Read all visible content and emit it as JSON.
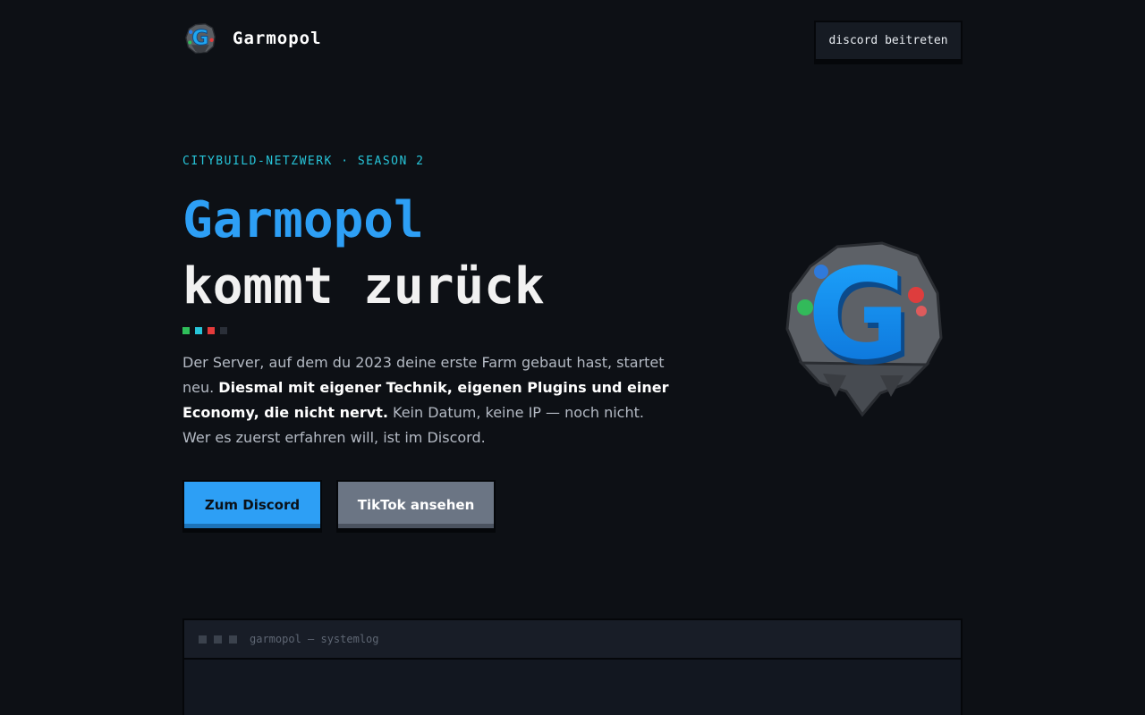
{
  "header": {
    "brand_name": "Garmopol",
    "discord_button": "discord beitreten"
  },
  "hero": {
    "eyebrow": "CITYBUILD-NETZWERK · SEASON 2",
    "headline_line1": "Garmopol",
    "headline_line2": "kommt zurück",
    "lead_part1": "Der Server, auf dem du 2023 deine erste Farm gebaut hast, startet neu. ",
    "lead_bold": "Diesmal mit eigener Technik, eigenen Plugins und einer Economy, die nicht nervt.",
    "lead_part2": " Kein Datum, keine IP — noch nicht. Wer es zuerst erfahren will, ist im Discord.",
    "primary_button": "Zum Discord",
    "secondary_button": "TikTok ansehen",
    "dot_colors": [
      "#2fbf5a",
      "#27c5d9",
      "#e53b3b",
      "#2a2f38"
    ]
  },
  "terminal": {
    "title": "garmopol — systemlog"
  },
  "colors": {
    "background": "#0d1015",
    "accent_blue": "#2d9ff5",
    "accent_cyan": "#27c5d9",
    "secondary_button": "#6b7584"
  }
}
